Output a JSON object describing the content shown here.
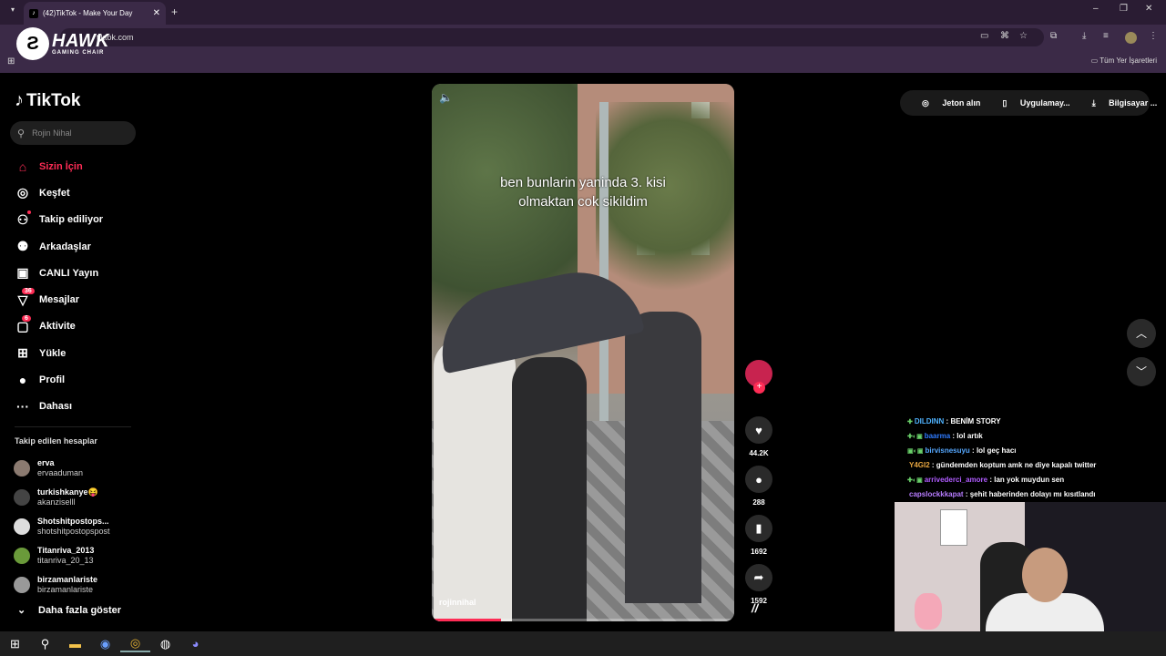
{
  "browser": {
    "tab_title": "(42)TikTok - Make Your Day",
    "tab_close": "✕",
    "new_tab": "+",
    "url": "tiktok.com",
    "bookmarks_all": "Tüm Yer İşaretleri",
    "window_min": "–",
    "window_restore": "❐",
    "window_close": "✕"
  },
  "overlay": {
    "brand": "HAWK",
    "brand_sub": "GAMING CHAIR"
  },
  "tiktok": {
    "logo": "TikTok",
    "search_placeholder": "Rojin Nihal",
    "nav": [
      {
        "label": "Sizin İçin",
        "icon": "home-icon",
        "glyph": "⌂"
      },
      {
        "label": "Keşfet",
        "icon": "compass-icon",
        "glyph": "◎"
      },
      {
        "label": "Takip ediliyor",
        "icon": "following-icon",
        "glyph": "⚇"
      },
      {
        "label": "Arkadaşlar",
        "icon": "friends-icon",
        "glyph": "⚉"
      },
      {
        "label": "CANLI Yayın",
        "icon": "live-icon",
        "glyph": "▣"
      },
      {
        "label": "Mesajlar",
        "icon": "messages-icon",
        "glyph": "▽",
        "badge": "36"
      },
      {
        "label": "Aktivite",
        "icon": "activity-icon",
        "glyph": "▢",
        "badge": "6"
      },
      {
        "label": "Yükle",
        "icon": "upload-icon",
        "glyph": "⊞"
      },
      {
        "label": "Profil",
        "icon": "profile-icon",
        "glyph": "●"
      },
      {
        "label": "Dahası",
        "icon": "more-icon",
        "glyph": "···"
      }
    ],
    "following_header": "Takip edilen hesaplar",
    "following": [
      {
        "name": "erva",
        "user": "ervaaduman",
        "color": "#8b7a70"
      },
      {
        "name": "turkishkanye😝",
        "user": "akanziselll",
        "color": "#444"
      },
      {
        "name": "Shotshitpostops...",
        "user": "shotshitpostopspost",
        "color": "#ddd"
      },
      {
        "name": "Titanriva_2013",
        "user": "titanriva_20_13",
        "color": "#6a9a3a"
      },
      {
        "name": "birzamanlariste",
        "user": "birzamanlariste",
        "color": "#999"
      }
    ],
    "show_more": "Daha fazla göster"
  },
  "video": {
    "caption_line1": "ben bunlarin yaninda 3. kisi",
    "caption_line2": "olmaktan cok sikildim",
    "username": "rojinnihal",
    "progress": 0.23,
    "likes": "44.2K",
    "comments": "288",
    "saves": "1692",
    "shares": "1592",
    "watermark": "//"
  },
  "topright": {
    "coins": "Jeton alın",
    "app": "Uygulamay...",
    "pc": "Bilgisayar ..."
  },
  "chat": [
    {
      "badges": "✚",
      "user": "DILDINN",
      "color": "#4fb3ff",
      "text": "BENİM STORY"
    },
    {
      "badges": "✚◐▣",
      "user": "baarma",
      "color": "#2f7bff",
      "text": "lol artık"
    },
    {
      "badges": "▣◐▣",
      "user": "birvisnesuyu",
      "color": "#56a8ff",
      "text": "lol geç hacı"
    },
    {
      "badges": "",
      "user": "Y4GI2",
      "color": "#e8a640",
      "text": "gündemden koptum amk ne diye kapalı twitter"
    },
    {
      "badges": "✚◐▣",
      "user": "arrivederci_amore",
      "color": "#b05cff",
      "text": "lan yok muydun sen"
    },
    {
      "badges": "",
      "user": "capslockkkapat",
      "color": "#b77cff",
      "text": "şehit haberinden dolayı mı kısıtlandı"
    }
  ]
}
